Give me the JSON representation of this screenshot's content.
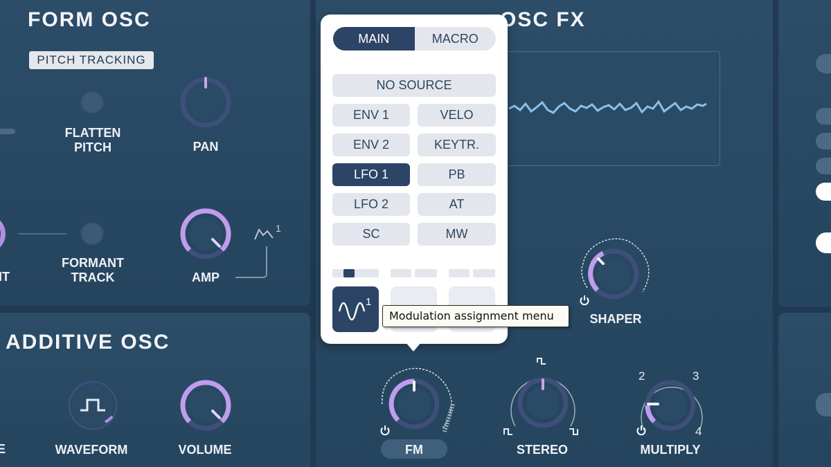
{
  "form_osc": {
    "title": "FORM OSC",
    "pitch_tracking": "PITCH TRACKING",
    "flatten_pitch": "FLATTEN\nPITCH",
    "pan": "PAN",
    "cut_label": "IT",
    "formant_track": "FORMANT\nTRACK",
    "amp": "AMP"
  },
  "additive_osc": {
    "title": "ADDITIVE OSC",
    "cut_label": "E",
    "waveform": "WAVEFORM",
    "volume": "VOLUME"
  },
  "osc_fx": {
    "title": "OSC FX",
    "shaper": "SHAPER",
    "fm": "FM",
    "stereo": "STEREO",
    "multiply": "MULTIPLY",
    "multiply_ticks": [
      "2",
      "3",
      "4"
    ]
  },
  "mod_menu": {
    "tabs": [
      "MAIN",
      "MACRO"
    ],
    "active_tab": "MAIN",
    "no_source": "NO SOURCE",
    "sources": [
      "ENV 1",
      "VELO",
      "ENV 2",
      "KEYTR.",
      "LFO 1",
      "PB",
      "LFO 2",
      "AT",
      "SC",
      "MW"
    ],
    "selected_source": "LFO 1",
    "slot_badge": "1",
    "amp_mod_badge": "1"
  },
  "tooltip": "Modulation assignment menu",
  "colors": {
    "accent": "#b28ee0",
    "panel": "#2c4d68",
    "selected": "#2c4466",
    "waveform": "#8cc0ea"
  }
}
